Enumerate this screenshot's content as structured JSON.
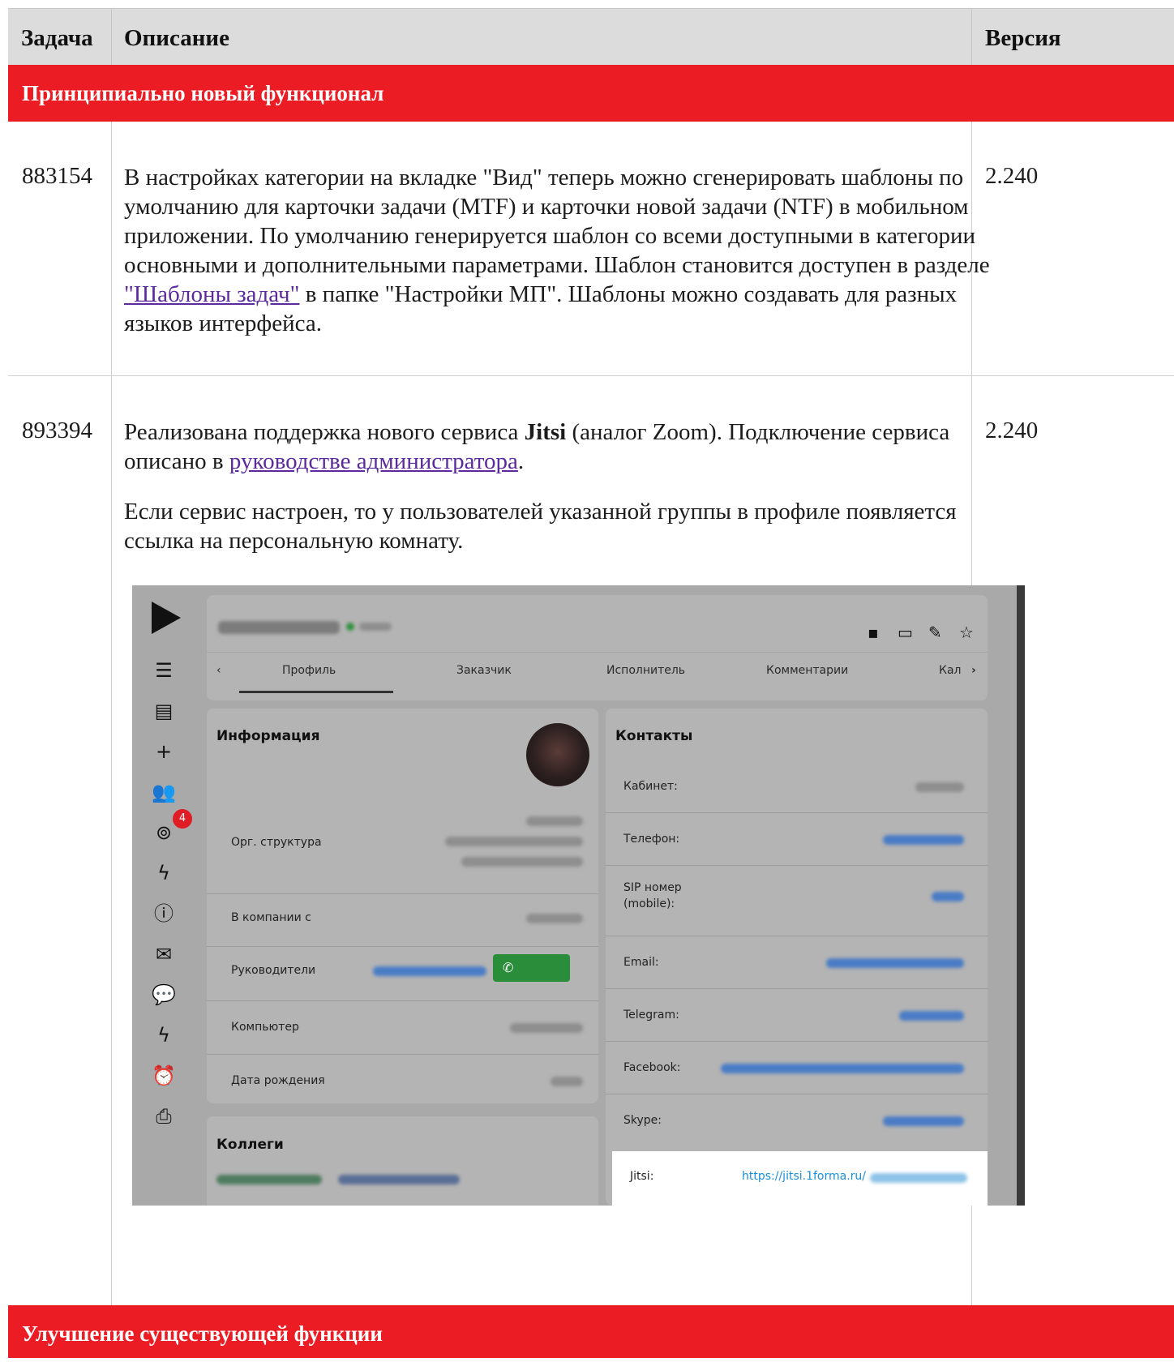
{
  "table": {
    "headers": {
      "task": "Задача",
      "description": "Описание",
      "version": "Версия"
    },
    "sections": [
      {
        "title": "Принципиально новый функционал"
      },
      {
        "title": "Улучшение существующей функции"
      }
    ],
    "rows": [
      {
        "id": "883154",
        "version": "2.240",
        "desc_before_link": "В настройках категории на вкладке \"Вид\" теперь можно сгенерировать шаблоны по умолчанию для карточки задачи (MTF) и карточки новой задачи (NTF) в мобильном приложении. По умолчанию генерируется шаблон со всеми доступными в категории основными и дополнительными параметрами. Шаблон становится доступен в разделе ",
        "desc_link": "\"Шаблоны задач\"",
        "desc_after_link": " в папке \"Настройки МП\". Шаблоны можно создавать для разных языков интерфейса."
      },
      {
        "id": "893394",
        "version": "2.240",
        "p1_before": "Реализована поддержка нового сервиса ",
        "p1_bold": "Jitsi",
        "p1_middle": " (аналог Zoom). Подключение сервиса описано в ",
        "p1_link": "руководстве администратора",
        "p1_after": ".",
        "p2": "Если сервис настроен, то у пользователей указанной группы в профиле появляется ссылка на персональную комнату."
      }
    ]
  },
  "screenshot": {
    "badge_count": "4",
    "tabs": [
      "Профиль",
      "Заказчик",
      "Исполнитель",
      "Комментарии",
      "Кал"
    ],
    "info_card": {
      "title": "Информация",
      "labels": [
        "Орг. структура",
        "В компании с",
        "Руководители",
        "Компьютер",
        "Дата рождения"
      ]
    },
    "colleagues_card": {
      "title": "Коллеги"
    },
    "contacts_card": {
      "title": "Контакты",
      "labels": [
        "Кабинет:",
        "Телефон:",
        "SIP номер",
        "(mobile):",
        "Email:",
        "Telegram:",
        "Facebook:",
        "Skype:"
      ],
      "jitsi_label": "Jitsi:",
      "jitsi_link": "https://jitsi.1forma.ru/"
    },
    "rail_icons": [
      "play-logo-icon",
      "menu-icon",
      "board-icon",
      "plus-icon",
      "users-icon",
      "help-icon",
      "stats-icon",
      "alert-icon",
      "mail-icon",
      "chat-icon",
      "stats-icon-2",
      "alarm-icon",
      "inbox-icon"
    ]
  }
}
